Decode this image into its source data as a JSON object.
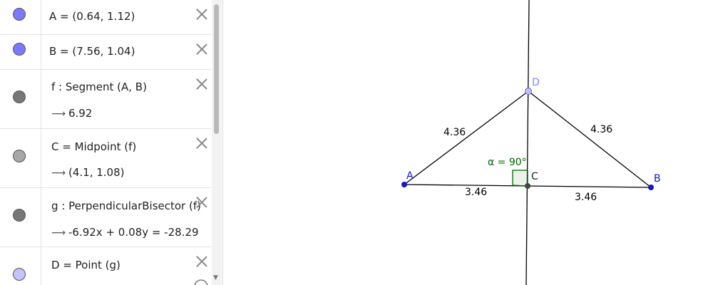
{
  "algebra": {
    "rows": [
      {
        "definition": "A = (0.64, 1.12)",
        "marble_color": "#7a7aff"
      },
      {
        "definition": "B = (7.56, 1.04)",
        "marble_color": "#7a7aff"
      },
      {
        "definition": "f : Segment (A, B)",
        "result": "6.92",
        "marble_color": "#777777"
      },
      {
        "definition": "C = Midpoint (f)",
        "result": "(4.1, 1.08)",
        "marble_color": "#a8a8a8"
      },
      {
        "definition": "g : PerpendicularBisector (f)",
        "result": "-6.92x + 0.08y = -28.29",
        "marble_color": "#777777"
      },
      {
        "definition": "D = Point (g)",
        "marble_color": "#c3c3ff"
      }
    ],
    "result_arrow": "⟶"
  },
  "graphics": {
    "points": {
      "A": "A",
      "B": "B",
      "C": "C",
      "D": "D"
    },
    "lengths": {
      "AD": "4.36",
      "DB": "4.36",
      "AC": "3.46",
      "CB": "3.46"
    },
    "angle_label": "α = 90°",
    "colors": {
      "free_point": "#1414d2",
      "dependent_point": "#8080ff",
      "angle": "#006400",
      "line": "#000000"
    }
  }
}
